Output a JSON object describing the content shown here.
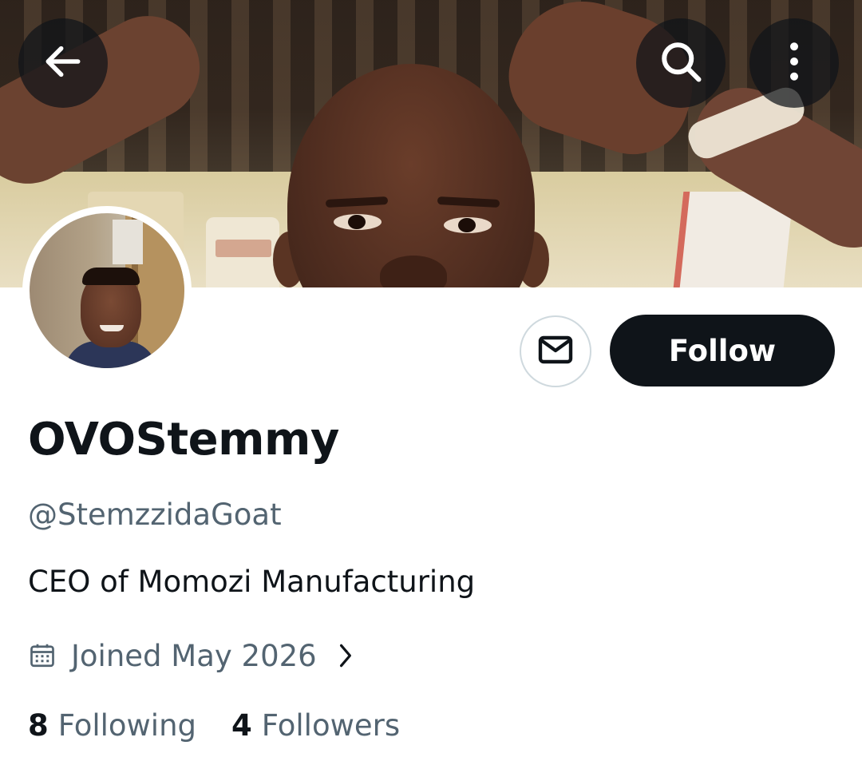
{
  "profile": {
    "display_name": "OVOStemmy",
    "handle": "@StemzzidaGoat",
    "bio": "CEO of Momozi Manufacturing",
    "joined": "Joined May 2026"
  },
  "actions": {
    "follow_label": "Follow"
  },
  "stats": {
    "following_count": "8",
    "following_label": "Following",
    "followers_count": "4",
    "followers_label": "Followers"
  },
  "icons": {
    "back": "arrow-left-icon",
    "search": "search-icon",
    "more": "more-vertical-icon",
    "message": "envelope-icon",
    "calendar": "calendar-icon",
    "chevron": "chevron-right-icon"
  },
  "colors": {
    "primary_text": "#0f1419",
    "secondary_text": "#536471",
    "follow_button_bg": "#0f1419",
    "border": "#cfd9de"
  }
}
